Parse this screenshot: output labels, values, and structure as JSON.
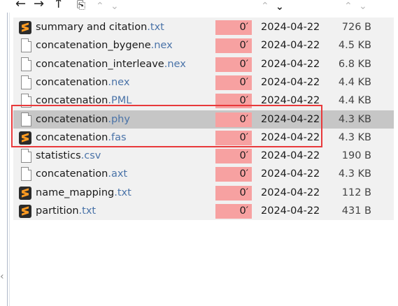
{
  "toolbar": {
    "back_icon": "←",
    "forward_icon": "→",
    "up_icon": "↑",
    "new_item_icon": "⎘",
    "chevron_up": "⌃",
    "chevron_down": "⌄"
  },
  "files": [
    {
      "base": "summary and citation",
      "ext": ".txt",
      "icon": "sublime-icon",
      "modified": "0′",
      "date": "2024-04-22",
      "size": "726 B",
      "selected": false
    },
    {
      "base": "concatenation_bygene",
      "ext": ".nex",
      "icon": "document-icon",
      "modified": "0′",
      "date": "2024-04-22",
      "size": "4.5 KB",
      "selected": false
    },
    {
      "base": "concatenation_interleave",
      "ext": ".nex",
      "icon": "document-icon",
      "modified": "0′",
      "date": "2024-04-22",
      "size": "6.8 KB",
      "selected": false
    },
    {
      "base": "concatenation",
      "ext": ".nex",
      "icon": "document-icon",
      "modified": "0′",
      "date": "2024-04-22",
      "size": "4.4 KB",
      "selected": false
    },
    {
      "base": "concatenation",
      "ext": ".PML",
      "icon": "document-icon",
      "modified": "0′",
      "date": "2024-04-22",
      "size": "4.4 KB",
      "selected": false
    },
    {
      "base": "concatenation",
      "ext": ".phy",
      "icon": "document-icon",
      "modified": "0′",
      "date": "2024-04-22",
      "size": "4.3 KB",
      "selected": true
    },
    {
      "base": "concatenation",
      "ext": ".fas",
      "icon": "sublime-icon",
      "modified": "0′",
      "date": "2024-04-22",
      "size": "4.3 KB",
      "selected": false
    },
    {
      "base": "statistics",
      "ext": ".csv",
      "icon": "document-icon",
      "modified": "0′",
      "date": "2024-04-22",
      "size": "190 B",
      "selected": false
    },
    {
      "base": "concatenation",
      "ext": ".axt",
      "icon": "document-icon",
      "modified": "0′",
      "date": "2024-04-22",
      "size": "4.3 KB",
      "selected": false
    },
    {
      "base": "name_mapping",
      "ext": ".txt",
      "icon": "sublime-icon",
      "modified": "0′",
      "date": "2024-04-22",
      "size": "112 B",
      "selected": false
    },
    {
      "base": "partition",
      "ext": ".txt",
      "icon": "sublime-icon",
      "modified": "0′",
      "date": "2024-04-22",
      "size": "431 B",
      "selected": false
    }
  ],
  "colors": {
    "highlight_box": "#e8393b",
    "modified_cell": "#f7a1a1",
    "selected_row": "#c6c6c6",
    "extension_text": "#4a73a8"
  }
}
